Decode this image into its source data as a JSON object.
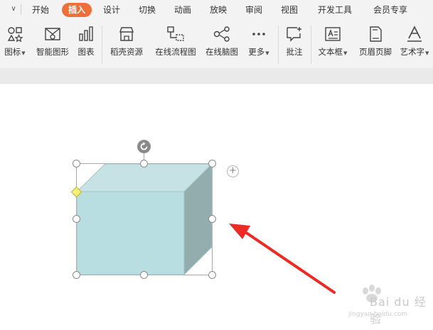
{
  "tabs": [
    {
      "label": "开始",
      "active": false
    },
    {
      "label": "插入",
      "active": true
    },
    {
      "label": "设计",
      "active": false
    },
    {
      "label": "切换",
      "active": false
    },
    {
      "label": "动画",
      "active": false
    },
    {
      "label": "放映",
      "active": false
    },
    {
      "label": "审阅",
      "active": false
    },
    {
      "label": "视图",
      "active": false
    },
    {
      "label": "开发工具",
      "active": false
    },
    {
      "label": "会员专享",
      "active": false
    }
  ],
  "ribbon": {
    "items": [
      {
        "label": "图标",
        "icon": "icon-set-icon",
        "dropdown": true
      },
      {
        "label": "智能图形",
        "icon": "smartart-icon",
        "dropdown": false
      },
      {
        "label": "图表",
        "icon": "bar-chart-icon",
        "dropdown": false
      },
      {
        "label": "稻壳资源",
        "icon": "store-icon",
        "dropdown": false
      },
      {
        "label": "在线流程图",
        "icon": "flowchart-icon",
        "dropdown": false
      },
      {
        "label": "在线脑图",
        "icon": "mindmap-icon",
        "dropdown": false
      },
      {
        "label": "更多",
        "icon": "more-dots-icon",
        "dropdown": true
      },
      {
        "label": "批注",
        "icon": "comment-icon",
        "dropdown": false
      },
      {
        "label": "文本框",
        "icon": "textbox-icon",
        "dropdown": true
      },
      {
        "label": "页眉页脚",
        "icon": "header-footer-icon",
        "dropdown": false
      },
      {
        "label": "艺术字",
        "icon": "wordart-icon",
        "dropdown": true
      }
    ]
  },
  "canvas": {
    "shape": "cube",
    "shape_colors": {
      "front": "#b9dee1",
      "top": "#c7e2e4",
      "side": "#93adae",
      "edge": "#a3c2c4"
    },
    "arrow_color": "#ee2a24",
    "watermark": {
      "brand": "Bai du 经验",
      "url": "jingyan.baidu.com"
    }
  },
  "colors": {
    "accent": "#ef6f3a",
    "ribbon_bg": "#f3f3f3"
  }
}
